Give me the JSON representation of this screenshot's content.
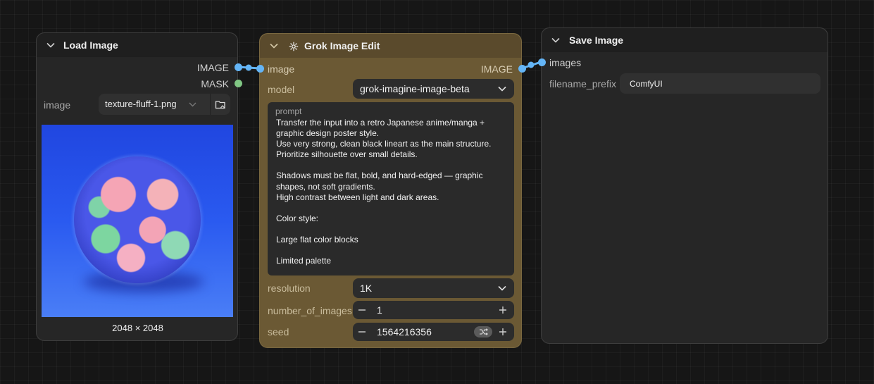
{
  "colors": {
    "image_slot": "#64b5f6",
    "mask_slot": "#81c784",
    "canvas": "#161616",
    "node_default": "#262626",
    "node_grok": "#6b5934"
  },
  "load_image": {
    "title": "Load Image",
    "outputs": [
      "IMAGE",
      "MASK"
    ],
    "widget_label": "image",
    "selected_file": "texture-fluff-1.png",
    "dimensions": "2048 × 2048",
    "preview_icon": "folder-image-icon"
  },
  "grok_edit": {
    "title": "Grok Image Edit",
    "title_icon": "grok-logo-icon",
    "input_label": "image",
    "output_label": "IMAGE",
    "model_label": "model",
    "model_value": "grok-imagine-image-beta",
    "prompt_label": "prompt",
    "prompt_text": "Transfer the input into a retro Japanese anime/manga + graphic design poster style.\nUse very strong, clean black lineart as the main structure.\nPrioritize silhouette over small details.\n\nShadows must be flat, bold, and hard-edged — graphic shapes, not soft gradients.\nHigh contrast between light and dark areas.\n\nColor style:\n\nLarge flat color blocks\n\nLimited palette",
    "resolution_label": "resolution",
    "resolution_value": "1K",
    "num_images_label": "number_of_images",
    "num_images_value": "1",
    "seed_label": "seed",
    "seed_value": "1564216356"
  },
  "save_image": {
    "title": "Save Image",
    "input_label": "images",
    "prefix_label": "filename_prefix",
    "prefix_value": "ComfyUI"
  }
}
